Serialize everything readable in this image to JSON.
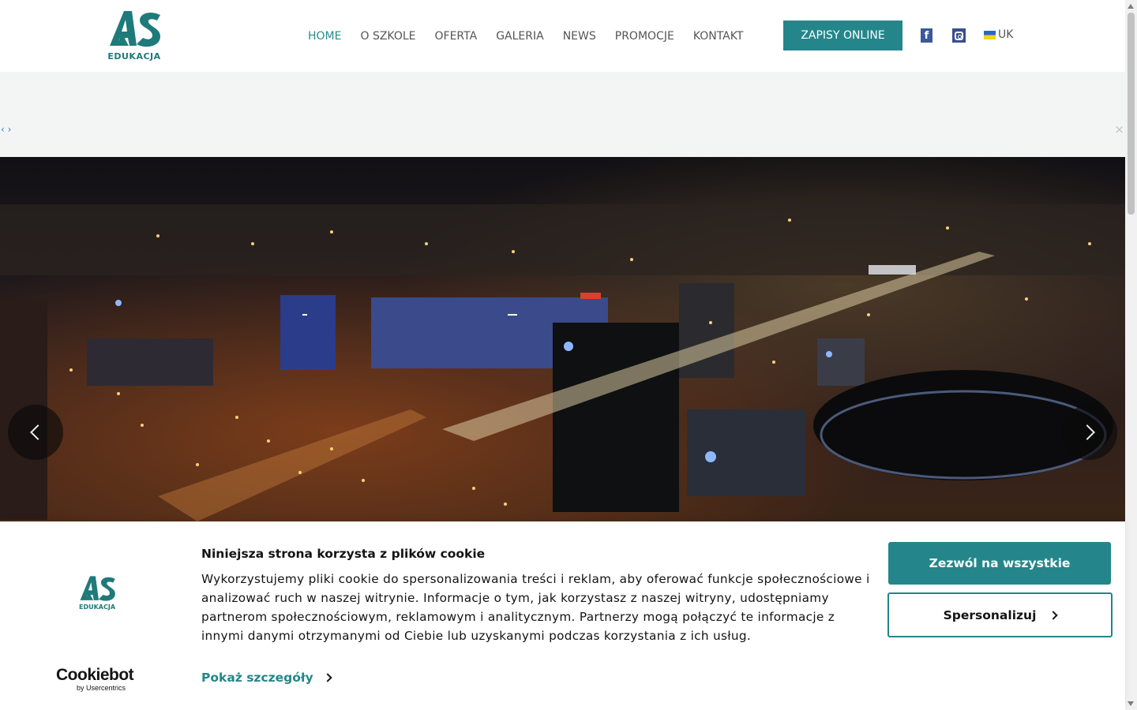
{
  "header": {
    "logo_text": "EDUKACJA",
    "nav": [
      "HOME",
      "O SZKOLE",
      "OFERTA",
      "GALERIA",
      "NEWS",
      "PROMOCJE",
      "KONTAKT"
    ],
    "active_nav": "HOME",
    "cta_label": "ZAPISY ONLINE",
    "facebook_glyph": "f",
    "lang_label": "UK"
  },
  "announcement_bar": {
    "arrows": "‹ ›",
    "close": "×"
  },
  "hero": {
    "image_alt": "night city panorama"
  },
  "cookie_banner": {
    "logo_text": "EDUKACJA",
    "title": "Niniejsza strona korzysta z plików cookie",
    "body": "Wykorzystujemy pliki cookie do spersonalizowania treści i reklam, aby oferować funkcje społecznościowe i analizować ruch w naszej witrynie. Informacje o tym, jak korzystasz z naszej witryny, udostępniamy partnerom społecznościowym, reklamowym i analitycznym. Partnerzy mogą połączyć te informacje z innymi danymi otrzymanymi od Ciebie lub uzyskanymi podczas korzystania z ich usług.",
    "details_link": "Pokaż szczegóły",
    "allow_all_label": "Zezwól na wszystkie",
    "customize_label": "Spersonalizuj",
    "provider_name": "Cookiebot",
    "provider_sub": "by Usercentrics"
  },
  "colors": {
    "brand_teal": "#24868a",
    "nav_active": "#2a8b8b",
    "nav_text": "#555555",
    "grey_bar": "#f3f5f4"
  }
}
